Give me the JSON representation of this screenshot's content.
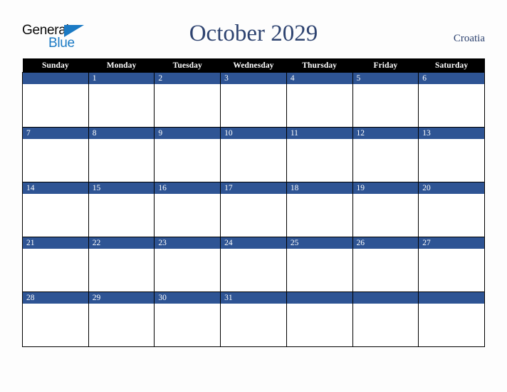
{
  "brand": {
    "name_part1": "General",
    "name_part2": "Blue",
    "triangle_color": "#1b7ac4",
    "text_color": "#0a0a0a"
  },
  "header": {
    "title": "October 2029",
    "country": "Croatia",
    "title_color": "#2e4370"
  },
  "calendar": {
    "month": "October",
    "year": "2029",
    "weekday_headers": [
      "Sunday",
      "Monday",
      "Tuesday",
      "Wednesday",
      "Thursday",
      "Friday",
      "Saturday"
    ],
    "header_bg": "#000000",
    "header_text_color": "#ffffff",
    "daybar_bg": "#2e5494",
    "daybar_text_color": "#ffffff",
    "cell_bg": "#ffffff",
    "grid_color": "#000000",
    "weeks": [
      [
        "",
        "1",
        "2",
        "3",
        "4",
        "5",
        "6"
      ],
      [
        "7",
        "8",
        "9",
        "10",
        "11",
        "12",
        "13"
      ],
      [
        "14",
        "15",
        "16",
        "17",
        "18",
        "19",
        "20"
      ],
      [
        "21",
        "22",
        "23",
        "24",
        "25",
        "26",
        "27"
      ],
      [
        "28",
        "29",
        "30",
        "31",
        "",
        "",
        ""
      ]
    ]
  }
}
